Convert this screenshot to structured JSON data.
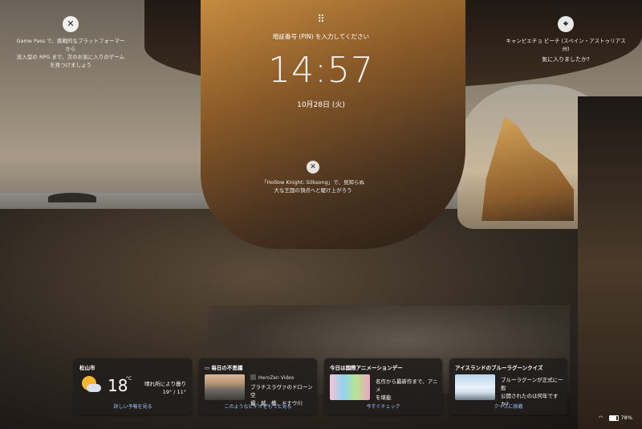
{
  "top_left": {
    "text_line1": "Game Pass で、挑戦的なプラットフォーマーから",
    "text_line2": "没入型の RPG まで、次のお気に入りのゲーム",
    "text_line3": "を見つけましょう"
  },
  "top_center": {
    "pin_prompt": "暗証番号 (PIN) を入力してください",
    "time": "14:57",
    "date": "10月28日 (火)"
  },
  "top_right": {
    "location": "キャンピエチョ ビーチ (スペイン・アストゥリアス州)",
    "question": "気に入りましたか?"
  },
  "center_notice": {
    "line1": "「Hollow Knight: Silksong」で、見知らぬ",
    "line2": "大な王国の頂点へと駆け上がろう"
  },
  "cards": {
    "weather": {
      "title": "松山市",
      "temp": "18",
      "unit": "°C",
      "condition": "晴れ所により曇り",
      "range": "19° / 11°",
      "link": "詳しい予報を見る"
    },
    "news": {
      "title": "毎日の不思議",
      "source": "HeroZen Video",
      "headline_line1": "ブラチスラヴァのドローン空",
      "headline_line2": "撮 : 城、橋、ドナウ川",
      "link": "このようなビデオをもっと見る"
    },
    "anime": {
      "title": "今日は国際アニメーションデー",
      "line1": "名作から最新作まで、アニメ",
      "line2": "を堪能",
      "link": "今すぐチェック"
    },
    "quiz": {
      "title": "アイスランドのブルーラグーンクイズ",
      "line1": "ブルーラグーンが正式に一般",
      "line2": "公開されたのは何年です",
      "line3": "か?",
      "link": "クイズに挑戦"
    }
  },
  "status": {
    "battery": "78%"
  },
  "icons": {
    "xbox": "xbox-icon",
    "keypad": "keypad-icon",
    "location": "location-pin-icon",
    "wifi": "wifi-icon",
    "battery": "battery-icon"
  }
}
